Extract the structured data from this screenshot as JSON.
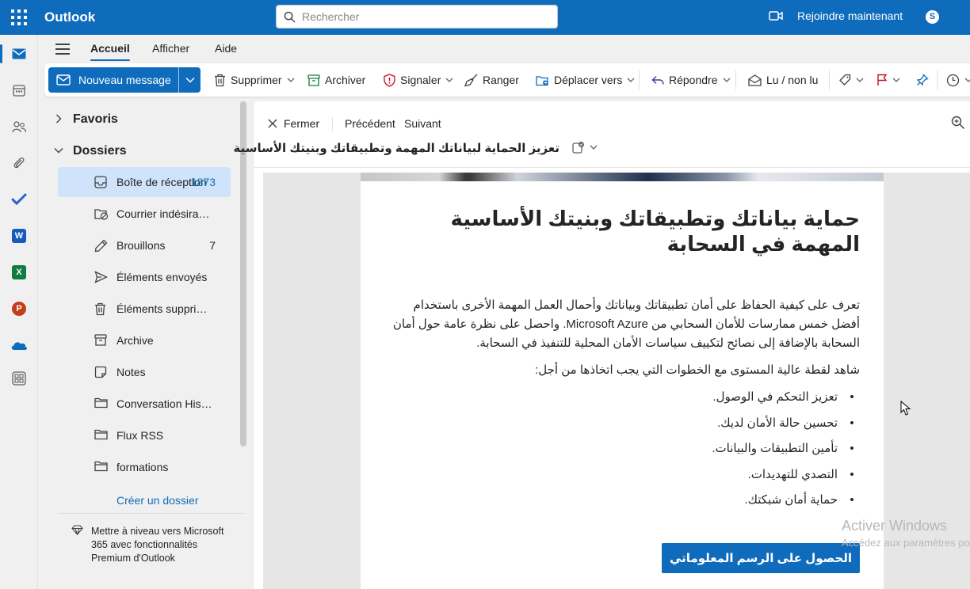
{
  "app": {
    "name": "Outlook",
    "search_placeholder": "Rechercher",
    "join_label": "Rejoindre maintenant"
  },
  "menu": {
    "tabs": [
      {
        "label": "Accueil",
        "active": true
      },
      {
        "label": "Afficher",
        "active": false
      },
      {
        "label": "Aide",
        "active": false
      }
    ]
  },
  "ribbon": {
    "new_message": "Nouveau message",
    "delete": "Supprimer",
    "archive": "Archiver",
    "report": "Signaler",
    "sweep": "Ranger",
    "move_to": "Déplacer vers",
    "reply": "Répondre",
    "read_unread": "Lu / non lu"
  },
  "folders": {
    "favorites": "Favoris",
    "folders_section": "Dossiers",
    "items": [
      {
        "label": "Boîte de réception",
        "count": "1873",
        "icon": "inbox-icon",
        "selected": true
      },
      {
        "label": "Courrier indésirable",
        "count": "",
        "icon": "junk-icon"
      },
      {
        "label": "Brouillons",
        "count": "7",
        "icon": "drafts-icon"
      },
      {
        "label": "Éléments envoyés",
        "count": "",
        "icon": "sent-icon"
      },
      {
        "label": "Éléments supprimés",
        "count": "",
        "icon": "trash-icon"
      },
      {
        "label": "Archive",
        "count": "",
        "icon": "archive-icon"
      },
      {
        "label": "Notes",
        "count": "",
        "icon": "notes-icon"
      },
      {
        "label": "Conversation History",
        "count": "",
        "icon": "folder-icon"
      },
      {
        "label": "Flux RSS",
        "count": "",
        "icon": "folder-icon"
      },
      {
        "label": "formations",
        "count": "",
        "icon": "folder-icon"
      }
    ],
    "create_folder": "Créer un dossier",
    "promo_text": "Mettre à niveau vers Microsoft 365 avec fonctionnalités Premium d'Outlook"
  },
  "reading": {
    "close": "Fermer",
    "previous": "Précédent",
    "next": "Suivant",
    "subject": "تعزيز الحماية لبياناتك المهمة وتطبيقاتك وبنيتك الأساسية",
    "email": {
      "title": "حماية بياناتك وتطبيقاتك وبنيتك الأساسية المهمة في السحابة",
      "paragraph1": "تعرف على كيفية الحفاظ على أمان تطبيقاتك وبياناتك وأحمال العمل المهمة الأخرى باستخدام أفضل خمس ممارسات للأمان السحابي من Microsoft Azure. واحصل على نظرة عامة حول أمان السحابة بالإضافة إلى نصائح لتكييف سياسات الأمان المحلية للتنفيذ في السحابة.",
      "paragraph2": "شاهد لقطة عالية المستوى مع الخطوات التي يجب اتخاذها من أجل:",
      "bullets": [
        "تعزيز التحكم في الوصول.",
        "تحسين حالة الأمان لديك.",
        "تأمين التطبيقات والبيانات.",
        "التصدي للتهديدات.",
        "حماية أمان شبكتك."
      ],
      "cta": "الحصول على الرسم المعلوماتي"
    }
  },
  "watermark": {
    "line1": "Activer Windows",
    "line2": "Accédez aux paramètres pour activer Windows."
  },
  "colors": {
    "brand": "#0f6cbd",
    "selected_bg": "#cfe4fa",
    "report_red": "#c50f1f"
  }
}
